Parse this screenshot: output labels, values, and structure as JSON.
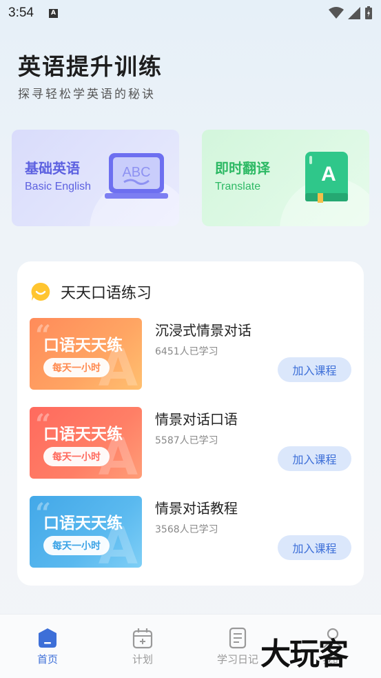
{
  "status": {
    "time": "3:54"
  },
  "header": {
    "title": "英语提升训练",
    "subtitle": "探寻轻松学英语的秘诀"
  },
  "cards": [
    {
      "title": "基础英语",
      "subtitle": "Basic English",
      "icon": "abc-laptop-icon",
      "icon_text": "ABC"
    },
    {
      "title": "即时翻译",
      "subtitle": "Translate",
      "icon": "translate-book-icon",
      "icon_text": "A"
    }
  ],
  "section": {
    "title": "天天口语练习",
    "icon": "chat-bubble-icon"
  },
  "courses": [
    {
      "thumb_title": "口语天天练",
      "thumb_pill": "每天一小时",
      "name": "沉浸式情景对话",
      "count": "6451人已学习",
      "button": "加入课程"
    },
    {
      "thumb_title": "口语天天练",
      "thumb_pill": "每天一小时",
      "name": "情景对话口语",
      "count": "5587人已学习",
      "button": "加入课程"
    },
    {
      "thumb_title": "口语天天练",
      "thumb_pill": "每天一小时",
      "name": "情景对话教程",
      "count": "3568人已学习",
      "button": "加入课程"
    }
  ],
  "tabbar": {
    "items": [
      {
        "label": "首页",
        "icon": "home-icon",
        "active": true
      },
      {
        "label": "计划",
        "icon": "calendar-icon",
        "active": false
      },
      {
        "label": "学习日记",
        "icon": "notebook-icon",
        "active": false
      },
      {
        "label": "我的",
        "icon": "profile-icon",
        "active": false
      }
    ]
  },
  "watermark": "大玩客",
  "colors": {
    "accent": "#3d6fd8",
    "basic": "#5c60e0",
    "translate": "#2cb964"
  }
}
